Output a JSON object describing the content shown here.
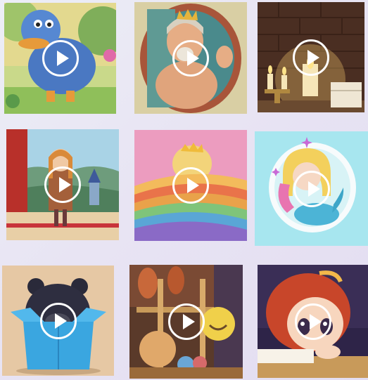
{
  "grid": {
    "tiles": [
      {
        "subject": "duck",
        "icon": "play-icon"
      },
      {
        "subject": "king-mirror",
        "icon": "play-icon"
      },
      {
        "subject": "candles",
        "icon": "play-icon"
      },
      {
        "subject": "princess-castle",
        "icon": "play-icon"
      },
      {
        "subject": "rainbow-princess",
        "icon": "play-icon"
      },
      {
        "subject": "mermaid",
        "icon": "play-icon"
      },
      {
        "subject": "bear-box",
        "icon": "play-icon"
      },
      {
        "subject": "toy-shop",
        "icon": "play-icon"
      },
      {
        "subject": "girl-reading",
        "icon": "play-icon"
      }
    ]
  },
  "colors": {
    "page_background": "#e8e6f4",
    "play_icon": "#ffffff"
  }
}
